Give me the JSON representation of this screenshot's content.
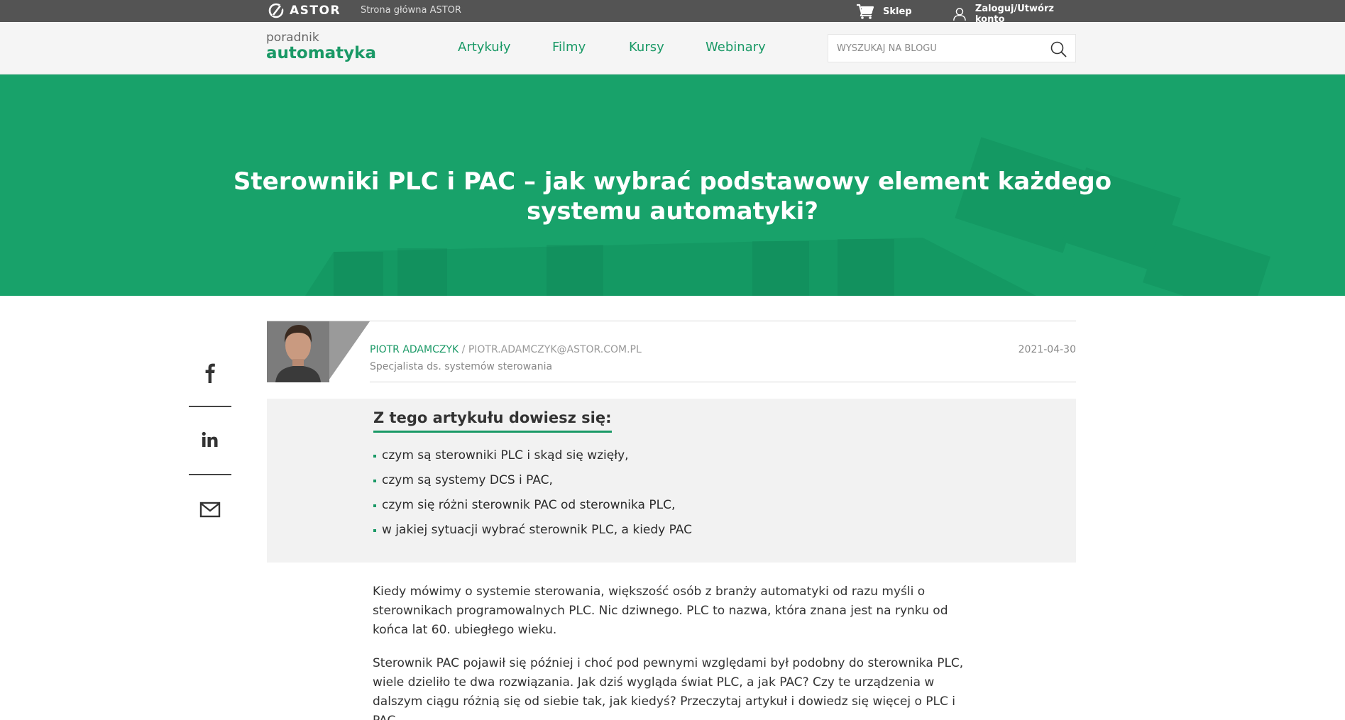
{
  "topbar": {
    "logo_text": "ASTOR",
    "home_link": "Strona główna ASTOR",
    "shop_label": "Sklep",
    "login_label": "Zaloguj/Utwórz konto"
  },
  "navbar": {
    "brand_small": "poradnik",
    "brand_big": "automatyka",
    "items": [
      {
        "label": "Artykuły"
      },
      {
        "label": "Filmy"
      },
      {
        "label": "Kursy"
      },
      {
        "label": "Webinary"
      }
    ],
    "search_placeholder": "WYSZUKAJ NA BLOGU"
  },
  "hero": {
    "title": "Sterowniki PLC i PAC – jak wybrać podstawowy element każdego systemu automatyki?"
  },
  "social": {
    "icons": [
      "facebook-icon",
      "linkedin-icon",
      "mail-icon"
    ]
  },
  "author": {
    "name": "PIOTR ADAMCZYK",
    "separator": " / ",
    "email": "PIOTR.ADAMCZYK@ASTOR.COM.PL",
    "role": "Specjalista ds. systemów sterowania",
    "date": "2021-04-30"
  },
  "summary": {
    "heading": "Z tego artykułu dowiesz się:",
    "items": [
      "czym są sterowniki PLC i skąd się wzięły,",
      "czym są systemy DCS i PAC,",
      "czym się różni sterownik PAC od sterownika PLC,",
      "w jakiej sytuacji wybrać sterownik PLC, a kiedy PAC"
    ]
  },
  "body": {
    "paragraphs": [
      "Kiedy mówimy o systemie sterowania, większość osób z branży automatyki od razu myśli o sterownikach programowalnych PLC. Nic dziwnego. PLC to nazwa, która znana jest na rynku od końca lat 60. ubiegłego wieku.",
      "Sterownik PAC pojawił się później i choć pod pewnymi względami był podobny do sterownika PLC, wiele dzieliło te dwa rozwiązania. Jak dziś wygląda świat PLC, a jak PAC? Czy te urządzenia w dalszym ciągu różnią się od siebie tak, jak kiedyś? Przeczytaj artykuł i dowiedz się więcej o PLC i PAC."
    ]
  },
  "colors": {
    "accent": "#1a9966",
    "hero_bg": "#18a26a",
    "topbar_bg": "#545454",
    "summary_bg": "#f2f2f2"
  }
}
